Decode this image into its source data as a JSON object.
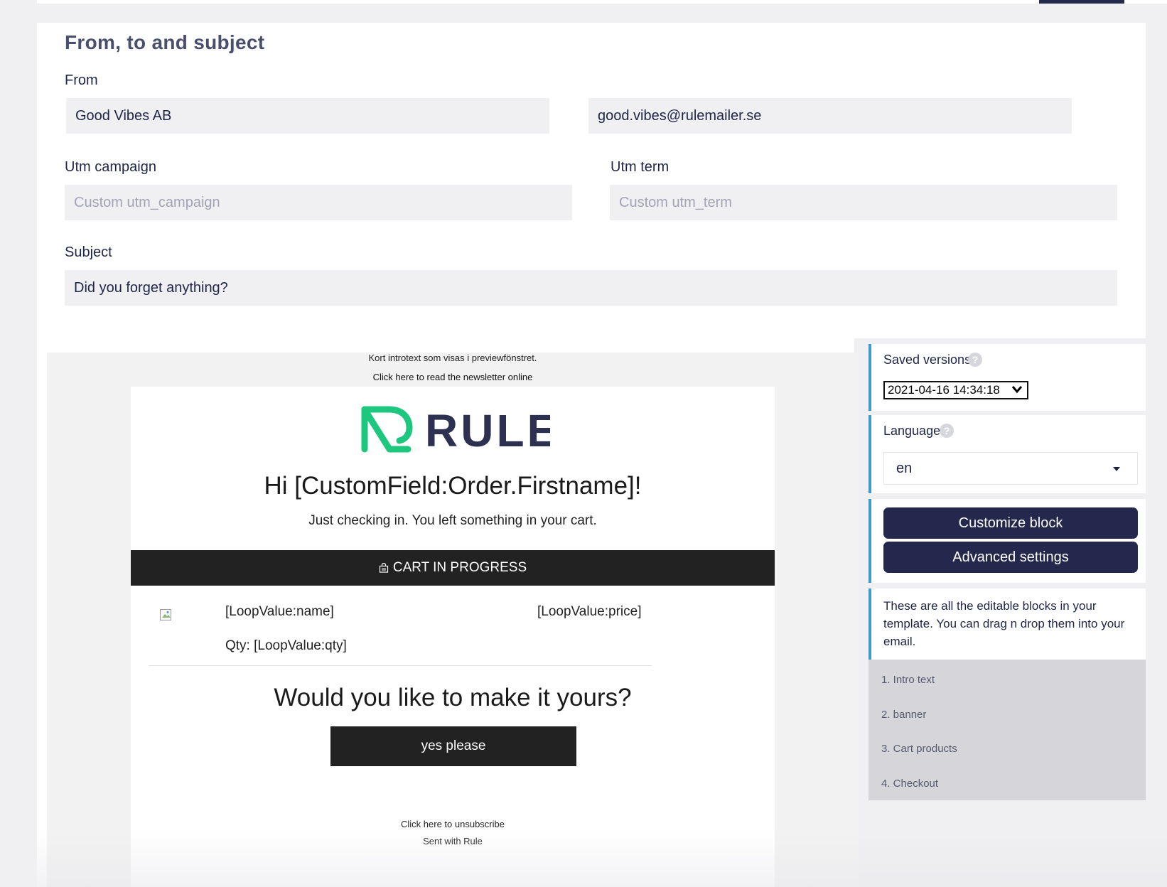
{
  "form": {
    "title": "From, to and subject",
    "from_label": "From",
    "from_name": "Good Vibes AB",
    "from_email": "good.vibes@rulemailer.se",
    "utm_campaign_label": "Utm campaign",
    "utm_campaign_placeholder": "Custom utm_campaign",
    "utm_term_label": "Utm term",
    "utm_term_placeholder": "Custom utm_term",
    "subject_label": "Subject",
    "subject_value": "Did you forget anything?"
  },
  "preview": {
    "intro_text": "Kort introtext som visas i previewfönstret.",
    "read_online": "Click here to read the newsletter online",
    "logo_text": "RULE",
    "greeting": "Hi [CustomField:Order.Firstname]!",
    "checking_in": "Just checking in. You left something in your cart.",
    "cart_banner": "CART IN PROGRESS",
    "product_name": "[LoopValue:name]",
    "product_price": "[LoopValue:price]",
    "product_qty": "Qty: [LoopValue:qty]",
    "cta_heading": "Would you like to make it yours?",
    "cta_button": "yes please",
    "unsubscribe": "Click here to unsubscribe",
    "sent_with": "Sent with Rule",
    "logo_green": "#1dc77e",
    "logo_navy": "#2d3050"
  },
  "sidebar": {
    "saved_versions_label": "Saved versions",
    "saved_version_value": "2021-04-16 14:34:18",
    "language_label": "Language",
    "language_value": "en",
    "customize_block": "Customize block",
    "advanced_settings": "Advanced settings",
    "editable_note": "These are all the editable blocks in your template. You can drag n drop them into your email.",
    "blocks": [
      "1. Intro text",
      "2. banner",
      "3. Cart products",
      "4. Checkout"
    ]
  },
  "colors": {
    "primary_dark": "#24284d",
    "accent_blue": "#3d9ad6",
    "email_dark": "#222222"
  }
}
